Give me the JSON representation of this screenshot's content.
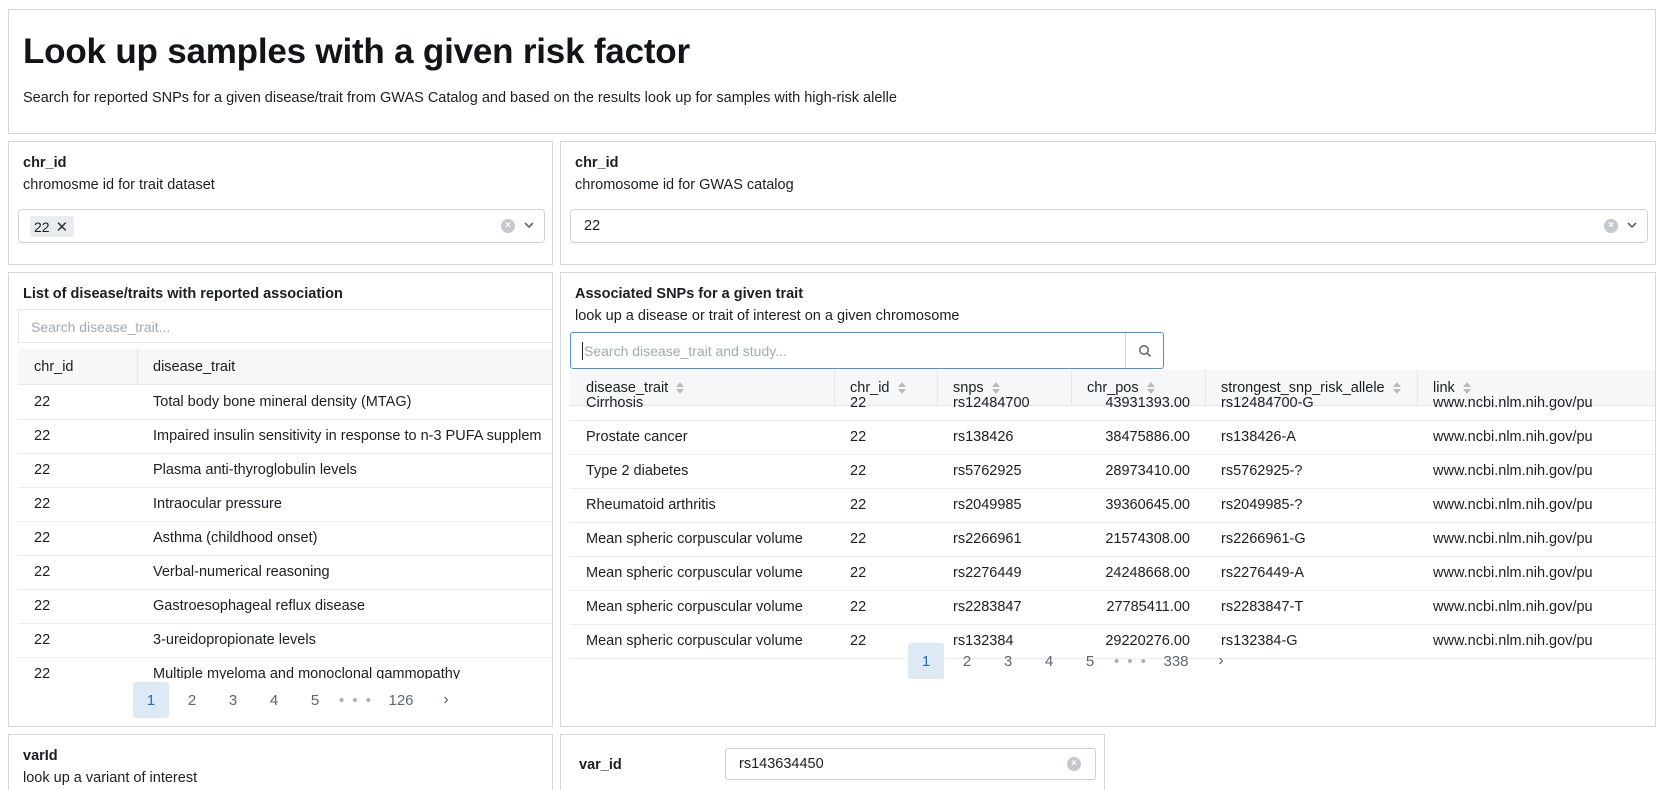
{
  "header": {
    "title": "Look up samples with a given risk factor",
    "subtitle": "Search for reported SNPs for a given disease/trait from GWAS Catalog and based on the results look up for samples with high-risk alelle"
  },
  "trait_chr": {
    "label": "chr_id",
    "description": "chromosme id for trait dataset",
    "selected": "22",
    "remove_glyph": "✕"
  },
  "gwas_chr": {
    "label": "chr_id",
    "description": "chromosome id for GWAS catalog",
    "value": "22"
  },
  "traits_table": {
    "title": "List of disease/traits with reported association",
    "search_placeholder": "Search disease_trait...",
    "columns": [
      "chr_id",
      "disease_trait"
    ],
    "rows": [
      [
        "22",
        "Total body bone mineral density (MTAG)"
      ],
      [
        "22",
        "Impaired insulin sensitivity in response to n-3 PUFA supplem"
      ],
      [
        "22",
        "Plasma anti-thyroglobulin levels"
      ],
      [
        "22",
        "Intraocular pressure"
      ],
      [
        "22",
        "Asthma (childhood onset)"
      ],
      [
        "22",
        "Verbal-numerical reasoning"
      ],
      [
        "22",
        "Gastroesophageal reflux disease"
      ],
      [
        "22",
        "3-ureidopropionate levels"
      ],
      [
        "22",
        "Multiple myeloma and monoclonal gammopathy"
      ]
    ],
    "pagination": {
      "pages": [
        "1",
        "2",
        "3",
        "4",
        "5"
      ],
      "ellipsis": "• • •",
      "last": "126",
      "current": "1",
      "next": "›"
    }
  },
  "snps_table": {
    "title": "Associated SNPs for a given trait",
    "description": "look up a disease or trait of interest on a given chromosome",
    "search_placeholder": "Search disease_trait and study...",
    "columns": [
      "disease_trait",
      "chr_id",
      "snps",
      "chr_pos",
      "strongest_snp_risk_allele",
      "link"
    ],
    "rows": [
      [
        "Cirrhosis",
        "22",
        "rs12484700",
        "43931393.00",
        "rs12484700-G",
        "www.ncbi.nlm.nih.gov/pu"
      ],
      [
        "Prostate cancer",
        "22",
        "rs138426",
        "38475886.00",
        "rs138426-A",
        "www.ncbi.nlm.nih.gov/pu"
      ],
      [
        "Type 2 diabetes",
        "22",
        "rs5762925",
        "28973410.00",
        "rs5762925-?",
        "www.ncbi.nlm.nih.gov/pu"
      ],
      [
        "Rheumatoid arthritis",
        "22",
        "rs2049985",
        "39360645.00",
        "rs2049985-?",
        "www.ncbi.nlm.nih.gov/pu"
      ],
      [
        "Mean spheric corpuscular volume",
        "22",
        "rs2266961",
        "21574308.00",
        "rs2266961-G",
        "www.ncbi.nlm.nih.gov/pu"
      ],
      [
        "Mean spheric corpuscular volume",
        "22",
        "rs2276449",
        "24248668.00",
        "rs2276449-A",
        "www.ncbi.nlm.nih.gov/pu"
      ],
      [
        "Mean spheric corpuscular volume",
        "22",
        "rs2283847",
        "27785411.00",
        "rs2283847-T",
        "www.ncbi.nlm.nih.gov/pu"
      ],
      [
        "Mean spheric corpuscular volume",
        "22",
        "rs132384",
        "29220276.00",
        "rs132384-G",
        "www.ncbi.nlm.nih.gov/pu"
      ]
    ],
    "pagination": {
      "pages": [
        "1",
        "2",
        "3",
        "4",
        "5"
      ],
      "ellipsis": "• • •",
      "last": "338",
      "current": "1",
      "next": "›"
    }
  },
  "var_lookup": {
    "label": "varId",
    "description": "look up a variant of interest"
  },
  "var_input": {
    "label": "var_id",
    "value": "rs143634450"
  },
  "colors": {
    "active_page_bg": "#dde9f5",
    "active_page_text": "#1f6fb4",
    "focus_border": "#4a90d9"
  }
}
